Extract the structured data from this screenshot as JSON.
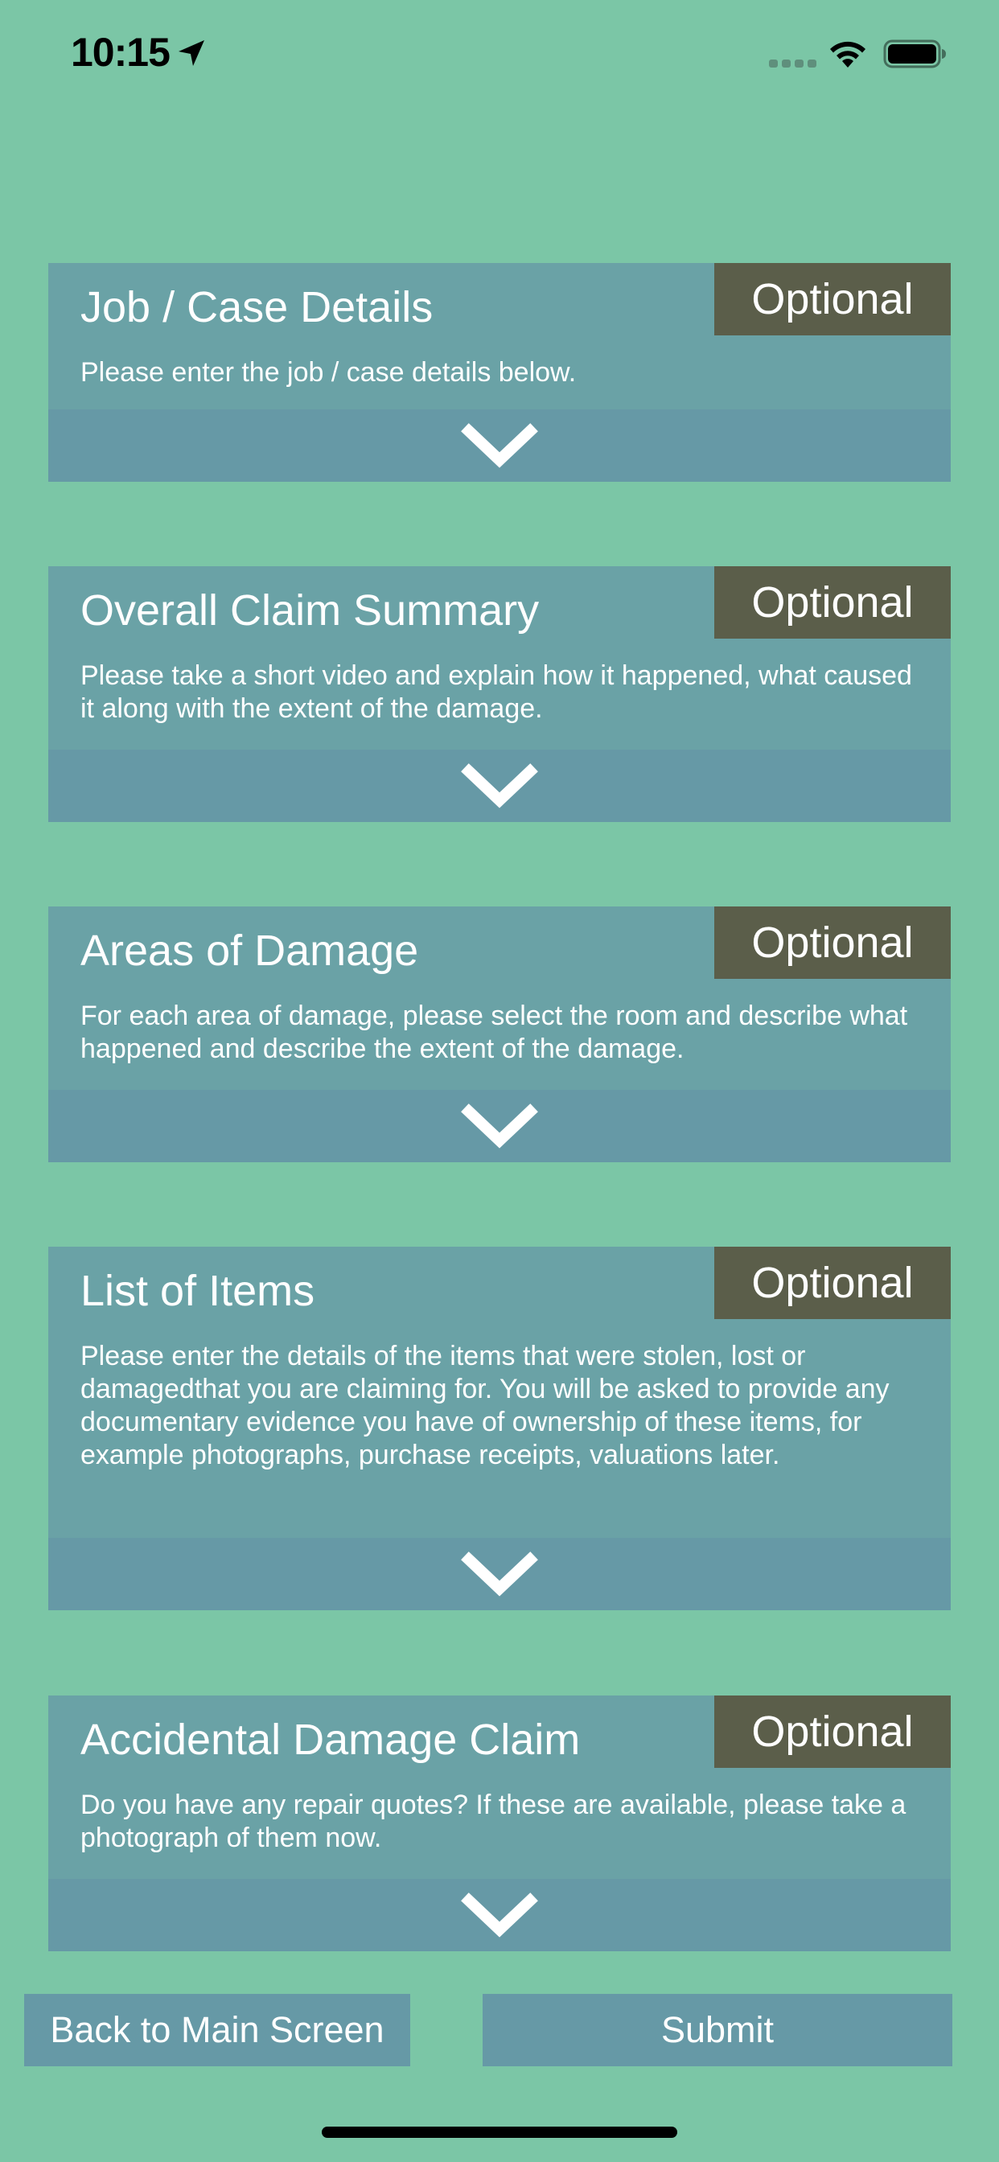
{
  "status_bar": {
    "time": "10:15",
    "icons": [
      "location-arrow-icon",
      "cellular-signal-icon",
      "wifi-icon",
      "battery-icon"
    ]
  },
  "sections": [
    {
      "title": "Job / Case Details",
      "badge": "Optional",
      "description": "Please enter the job / case details below."
    },
    {
      "title": "Overall Claim Summary",
      "badge": "Optional",
      "description": "Please take a short video and explain how it happened, what caused it along with the extent of the damage."
    },
    {
      "title": "Areas of Damage",
      "badge": "Optional",
      "description": "For each area of damage, please select the room and describe what happened and describe the extent of the damage."
    },
    {
      "title": "List of Items",
      "badge": "Optional",
      "description": "Please enter the details of the items that were stolen, lost or damagedthat you are claiming for. You will be asked to provide any documentary evidence you have of ownership of these items, for example photographs, purchase receipts, valuations later."
    },
    {
      "title": "Accidental Damage Claim",
      "badge": "Optional",
      "description": "Do you have any repair quotes? If these are available, please take a photograph of them now."
    }
  ],
  "buttons": {
    "back_label": "Back to Main Screen",
    "submit_label": "Submit"
  },
  "colors": {
    "background": "#7bc6a6",
    "card": "#6aa2a6",
    "expand_bar": "#6699a6",
    "badge": "#5b5e4a",
    "text": "#ffffff"
  }
}
